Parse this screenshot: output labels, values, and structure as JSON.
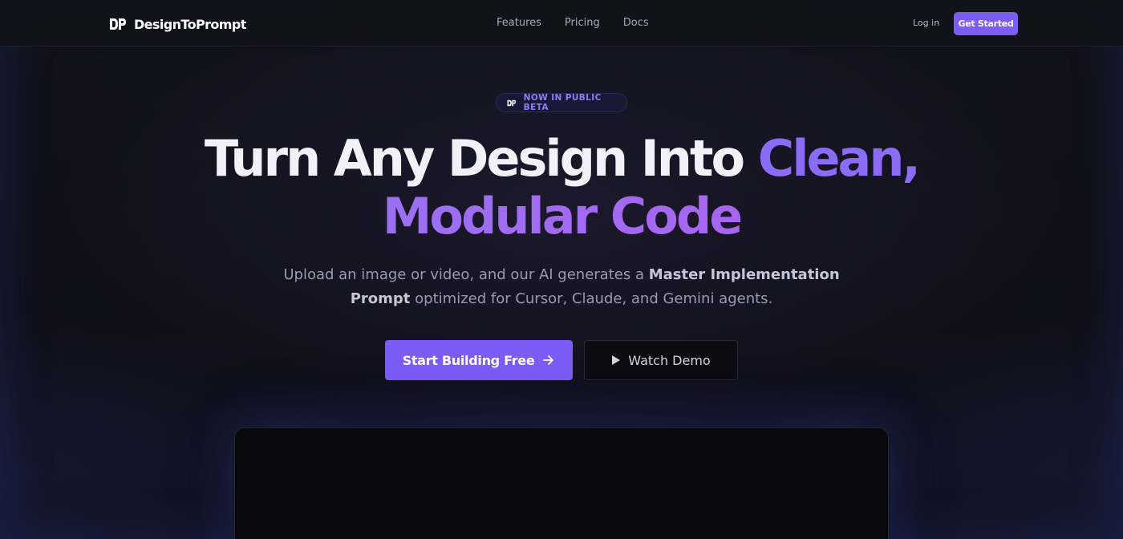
{
  "brand": {
    "name": "DesignToPrompt",
    "logo_icon": "dp-logo-icon"
  },
  "nav": {
    "links": [
      "Features",
      "Pricing",
      "Docs"
    ],
    "login_label": "Log in",
    "cta_label": "Get Started"
  },
  "hero": {
    "badge": "NOW IN PUBLIC BETA",
    "headline_white": "Turn Any Design Into",
    "headline_accent_1": "Clean,",
    "headline_accent_2": "Modular Code",
    "subtitle_pre": "Upload an image or video, and our AI generates a",
    "subtitle_bold": "Master Implementation Prompt",
    "subtitle_post": "optimized for Cursor, Claude, and Gemini agents.",
    "primary_cta": "Start Building Free",
    "primary_cta_icon": "arrow-right-icon",
    "secondary_cta": "Watch Demo",
    "secondary_cta_icon": "play-icon"
  },
  "colors": {
    "accent": "#7b5cf6",
    "background": "#11101a",
    "headline_accent": "#8b6cf8"
  }
}
